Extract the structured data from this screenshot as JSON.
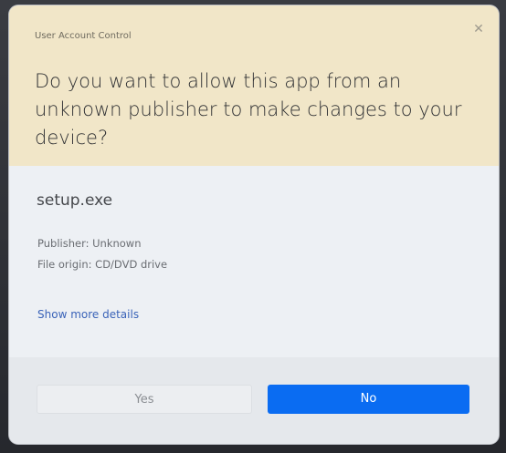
{
  "dialog": {
    "title": "User Account Control",
    "close_icon": "close-icon",
    "question": "Do you want to allow this app from an unknown publisher to make changes to your device?",
    "app_name": "setup.exe",
    "publisher": "Publisher: Unknown",
    "file_origin": "File origin: CD/DVD drive",
    "more_details_link": "Show more details",
    "yes_label": "Yes",
    "no_label": "No"
  },
  "colors": {
    "header_bg": "#f1e6c8",
    "body_bg": "#edf0f4",
    "primary_button": "#0a6cf2",
    "link": "#3a63b8"
  }
}
